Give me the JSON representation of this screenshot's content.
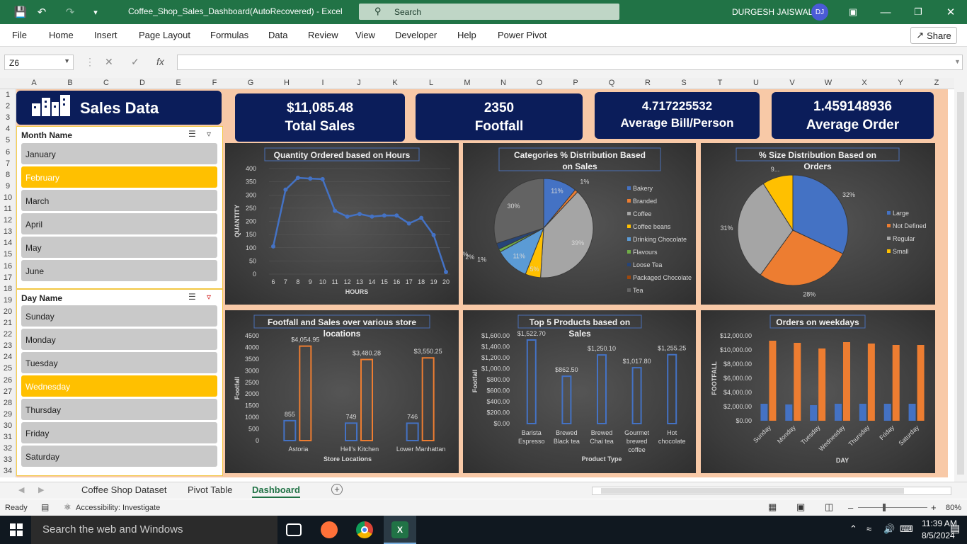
{
  "app": {
    "file_title": "Coffee_Shop_Sales_Dashboard(AutoRecovered)  -  Excel",
    "search_placeholder": "Search",
    "user_name": "DURGESH JAISWAL",
    "user_initials": "DJ"
  },
  "ribbon": {
    "tabs": [
      "File",
      "Home",
      "Insert",
      "Page Layout",
      "Formulas",
      "Data",
      "Review",
      "View",
      "Developer",
      "Help",
      "Power Pivot"
    ],
    "share": "Share"
  },
  "formula_bar": {
    "name_box": "Z6",
    "formula": ""
  },
  "columns": [
    "A",
    "B",
    "C",
    "D",
    "E",
    "F",
    "G",
    "H",
    "I",
    "J",
    "K",
    "L",
    "M",
    "N",
    "O",
    "P",
    "Q",
    "R",
    "S",
    "T",
    "U",
    "V",
    "W",
    "X",
    "Y",
    "Z"
  ],
  "rows": [
    "1",
    "2",
    "3",
    "4",
    "5",
    "6",
    "7",
    "8",
    "9",
    "10",
    "11",
    "12",
    "13",
    "14",
    "15",
    "16",
    "17",
    "18",
    "19",
    "20",
    "21",
    "22",
    "23",
    "24",
    "25",
    "26",
    "27",
    "28",
    "29",
    "30",
    "31",
    "32",
    "33",
    "34"
  ],
  "dashboard": {
    "title": "Sales Data",
    "kpis": [
      {
        "value": "$11,085.48",
        "label": "Total Sales"
      },
      {
        "value": "2350",
        "label": "Footfall"
      },
      {
        "value": "4.717225532",
        "label": "Average Bill/Person"
      },
      {
        "value": "1.459148936",
        "label": "Average Order"
      }
    ],
    "month_slicer": {
      "header": "Month Name",
      "items": [
        {
          "label": "January",
          "selected": false
        },
        {
          "label": "February",
          "selected": true
        },
        {
          "label": "March",
          "selected": false
        },
        {
          "label": "April",
          "selected": false
        },
        {
          "label": "May",
          "selected": false
        },
        {
          "label": "June",
          "selected": false
        }
      ]
    },
    "day_slicer": {
      "header": "Day Name",
      "items": [
        {
          "label": "Sunday",
          "selected": false
        },
        {
          "label": "Monday",
          "selected": false
        },
        {
          "label": "Tuesday",
          "selected": false
        },
        {
          "label": "Wednesday",
          "selected": true
        },
        {
          "label": "Thursday",
          "selected": false
        },
        {
          "label": "Friday",
          "selected": false
        },
        {
          "label": "Saturday",
          "selected": false
        }
      ]
    }
  },
  "chart_data": [
    {
      "type": "line",
      "title": "Quantity Ordered based on Hours",
      "xlabel": "HOURS",
      "ylabel": "QUANTITY",
      "x": [
        6,
        7,
        8,
        9,
        10,
        11,
        12,
        13,
        14,
        15,
        16,
        17,
        18,
        19,
        20
      ],
      "values": [
        105,
        320,
        365,
        362,
        360,
        240,
        218,
        228,
        218,
        222,
        222,
        192,
        213,
        148,
        8
      ],
      "ylim": [
        0,
        400
      ],
      "yticks": [
        "0",
        "50",
        "100",
        "150",
        "200",
        "250",
        "300",
        "350",
        "400"
      ]
    },
    {
      "type": "pie",
      "title": "Categories % Distribution Based on Sales",
      "categories": [
        "Bakery",
        "Branded",
        "Coffee",
        "Coffee beans",
        "Drinking Chocolate",
        "Flavours",
        "Loose Tea",
        "Packaged Chocolate",
        "Tea"
      ],
      "values": [
        11,
        1,
        39,
        5,
        11,
        1,
        2,
        0,
        30
      ],
      "labels": [
        "11%",
        "1%",
        "39%",
        "5%",
        "11%",
        "1%",
        "2%",
        "0%",
        "30%"
      ],
      "colors": [
        "#4472c4",
        "#ed7d31",
        "#a5a5a5",
        "#ffc000",
        "#5b9bd5",
        "#70ad47",
        "#264478",
        "#9e480e",
        "#636363"
      ],
      "legend_position": "right"
    },
    {
      "type": "pie",
      "title": "% Size Distribution Based on Orders",
      "categories": [
        "Large",
        "Not Defined",
        "Regular",
        "Small"
      ],
      "values": [
        32,
        28,
        31,
        9
      ],
      "labels": [
        "32%",
        "28%",
        "31%",
        "9..."
      ],
      "colors": [
        "#4472c4",
        "#ed7d31",
        "#a5a5a5",
        "#ffc000"
      ],
      "legend_position": "right"
    },
    {
      "type": "bar",
      "title": "Footfall and Sales over various store locations",
      "xlabel": "Store Locations",
      "ylabel": "Footfall",
      "categories": [
        "Astoria",
        "Hell's Kitchen",
        "Lower Manhattan"
      ],
      "series": [
        {
          "values": [
            855,
            749,
            746
          ],
          "labels": [
            "855",
            "749",
            "746"
          ],
          "color": "#4472c4"
        },
        {
          "values": [
            4054.95,
            3480.28,
            3550.25
          ],
          "labels": [
            "$4,054.95",
            "$3,480.28",
            "$3,550.25"
          ],
          "color": "#ed7d31"
        }
      ],
      "ylim": [
        0,
        4500
      ],
      "yticks": [
        "0",
        "500",
        "1000",
        "1500",
        "2000",
        "2500",
        "3000",
        "3500",
        "4000",
        "4500"
      ]
    },
    {
      "type": "bar",
      "title": "Top 5 Products based on Sales",
      "xlabel": "Product Type",
      "ylabel": "Footfall",
      "categories": [
        "Barista Espresso",
        "Brewed Black tea",
        "Brewed Chai tea",
        "Gourmet brewed coffee",
        "Hot chocolate"
      ],
      "values": [
        1522.7,
        862.5,
        1250.1,
        1017.8,
        1255.25
      ],
      "labels": [
        "$1,522.70",
        "$862.50",
        "$1,250.10",
        "$1,017.80",
        "$1,255.25"
      ],
      "ylim": [
        0,
        1600
      ],
      "yticks": [
        "$0.00",
        "$200.00",
        "$400.00",
        "$600.00",
        "$800.00",
        "$1,000.00",
        "$1,200.00",
        "$1,400.00",
        "$1,600.00"
      ]
    },
    {
      "type": "bar",
      "title": "Orders on weekdays",
      "xlabel": "DAY",
      "ylabel": "FOOTFALL",
      "categories": [
        "Sunday",
        "Monday",
        "Tuesday",
        "Wednesday",
        "Thursday",
        "Friday",
        "Saturday"
      ],
      "series": [
        {
          "values": [
            2400,
            2300,
            2200,
            2400,
            2400,
            2400,
            2400
          ],
          "color": "#4472c4"
        },
        {
          "values": [
            11300,
            11000,
            10200,
            11100,
            10900,
            10700,
            10700
          ],
          "color": "#ed7d31"
        }
      ],
      "ylim": [
        0,
        12000
      ],
      "yticks": [
        "$0.00",
        "$2,000.00",
        "$4,000.00",
        "$6,000.00",
        "$8,000.00",
        "$10,000.00",
        "$12,000.00"
      ]
    }
  ],
  "sheet_tabs": [
    {
      "label": "Coffee Shop Dataset",
      "active": false
    },
    {
      "label": "Pivot Table",
      "active": false
    },
    {
      "label": "Dashboard",
      "active": true
    }
  ],
  "status_bar": {
    "ready": "Ready",
    "accessibility": "Accessibility: Investigate",
    "zoom": "80%"
  },
  "taskbar": {
    "search_placeholder": "Search the web and Windows",
    "time": "11:39 AM",
    "date": "8/5/2024"
  }
}
